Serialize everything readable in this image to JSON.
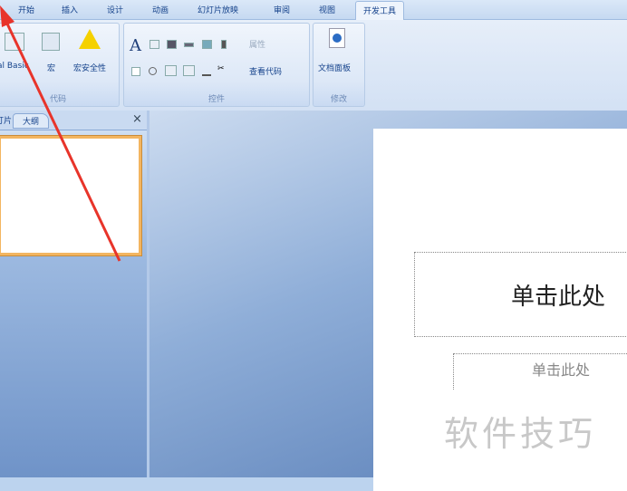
{
  "tabs": [
    "开始",
    "插入",
    "设计",
    "动画",
    "幻灯片放映",
    "审阅",
    "视图",
    "开发工具"
  ],
  "active_tab": "开发工具",
  "groups": {
    "code": {
      "label": "代码",
      "visual_basic": "al Basic",
      "macro": "宏",
      "macro_security": "宏安全性"
    },
    "controls": {
      "label": "控件",
      "properties": "属性",
      "view_code": "查看代码"
    },
    "modify": {
      "label": "修改",
      "doc_panel": "文档面板"
    }
  },
  "left_panel": {
    "tabs": [
      "幻灯片",
      "大纲"
    ],
    "close": "×"
  },
  "slide": {
    "title_placeholder": "单击此处",
    "subtitle_placeholder": "单击此处"
  },
  "watermark": "软件技巧"
}
